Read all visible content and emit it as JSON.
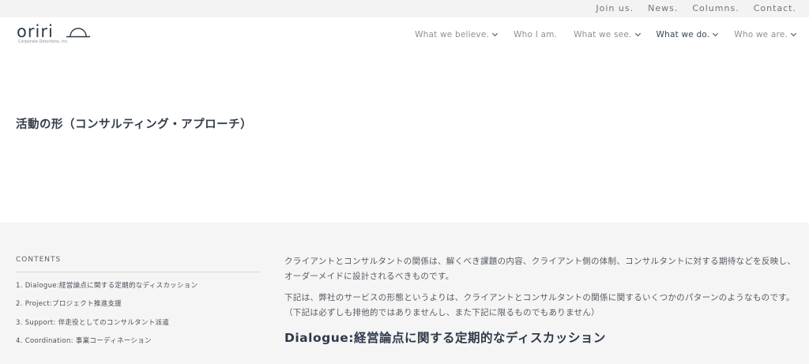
{
  "topbar": {
    "links": [
      "Join us.",
      "News.",
      "Columns.",
      "Contact."
    ]
  },
  "logo": {
    "wordmark": "oriri",
    "tagline": "Corporate Directions, Inc."
  },
  "nav": {
    "items": [
      {
        "label": "What we believe.",
        "has_dropdown": true
      },
      {
        "label": "Who I am.",
        "has_dropdown": false
      },
      {
        "label": "What we see.",
        "has_dropdown": true
      },
      {
        "label": "What we do.",
        "has_dropdown": true,
        "active": true
      },
      {
        "label": "Who we are.",
        "has_dropdown": true
      }
    ]
  },
  "hero": {
    "title": "活動の形（コンサルティング・アプローチ）"
  },
  "toc": {
    "heading": "CONTENTS",
    "items": [
      "1. Dialogue:経営論点に関する定期的なディスカッション",
      "2. Project:プロジェクト推進支援",
      "3. Support: 伴走役としてのコンサルタント派遣",
      "4. Coordination: 事業コーディネーション"
    ]
  },
  "main": {
    "paragraphs": [
      "クライアントとコンサルタントの関係は、解くべき課題の内容、クライアント側の体制、コンサルタントに対する期待などを反映し、オーダーメイドに設計されるべきものです。",
      "下記は、弊社のサービスの形態というよりは、クライアントとコンサルタントの関係に関するいくつかのパターンのようなものです。（下記は必ずしも排他的ではありませんし、また下記に限るものでもありません）"
    ],
    "section_title": "Dialogue:経営論点に関する定期的なディスカッション"
  }
}
